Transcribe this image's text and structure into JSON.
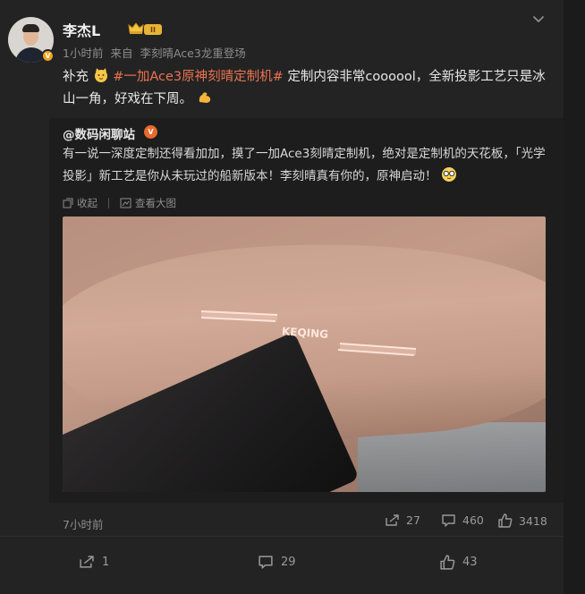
{
  "post": {
    "author": "李杰L",
    "time": "1小时前",
    "source_prefix": "来自",
    "source": "李刻晴Ace3龙重登场",
    "level": "II",
    "text_prefix": "补充",
    "topic": "#一加Ace3原神刻晴定制机#",
    "text_main": " 定制内容非常coooool，全新投影工艺只是冰山一角，好戏在下周。"
  },
  "repost": {
    "author": "@数码闲聊站",
    "text": "有一说一深度定制还得看加加，摸了一加Ace3刻晴定制机，绝对是定制机的天花板，「光学投影」新工艺是你从未玩过的船新版本！李刻晴真有你的，原神启动！",
    "collect_label": "收起",
    "view_large_label": "查看大图",
    "image_text": "KEQING",
    "time": "7小时前",
    "shares": "27",
    "comments": "460",
    "likes": "3418"
  },
  "actions": {
    "share_count": "1",
    "comment_count": "29",
    "like_count": "43"
  },
  "colors": {
    "accent": "#eb7350",
    "background": "#232323",
    "repost_background": "#1d1d1d",
    "verified_badge": "#f0a020"
  },
  "icons": [
    "chevron-down-icon",
    "crown-icon",
    "verified-icon",
    "collapse-icon",
    "view-large-icon",
    "share-icon",
    "comment-icon",
    "like-icon"
  ]
}
